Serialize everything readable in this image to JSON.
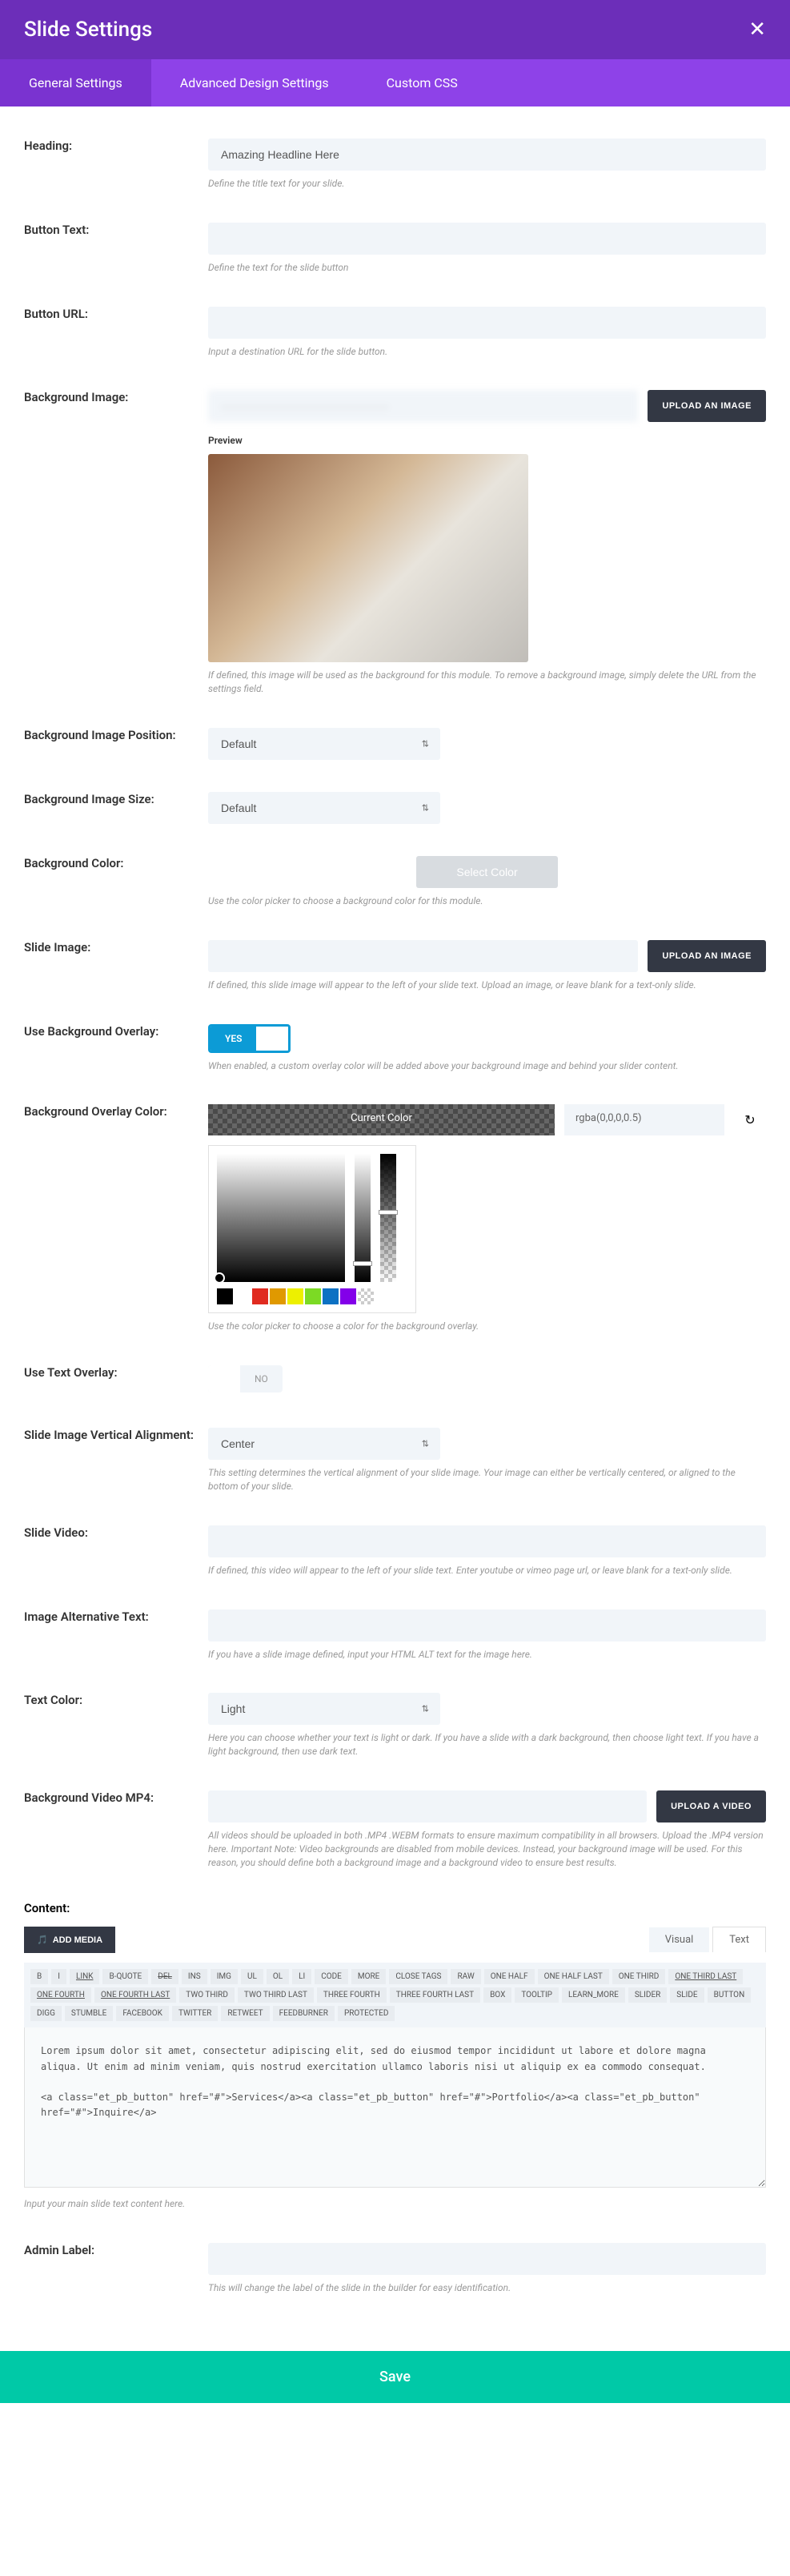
{
  "header": {
    "title": "Slide Settings"
  },
  "tabs": {
    "general": "General Settings",
    "advanced": "Advanced Design Settings",
    "css": "Custom CSS"
  },
  "fields": {
    "heading": {
      "label": "Heading:",
      "value": "Amazing Headline Here",
      "help": "Define the title text for your slide."
    },
    "button_text": {
      "label": "Button Text:",
      "help": "Define the text for the slide button"
    },
    "button_url": {
      "label": "Button URL:",
      "help": "Input a destination URL for the slide button."
    },
    "bg_image": {
      "label": "Background Image:",
      "upload": "UPLOAD AN IMAGE",
      "preview": "Preview",
      "help": "If defined, this image will be used as the background for this module. To remove a background image, simply delete the URL from the settings field."
    },
    "bg_pos": {
      "label": "Background Image Position:",
      "value": "Default"
    },
    "bg_size": {
      "label": "Background Image Size:",
      "value": "Default"
    },
    "bg_color": {
      "label": "Background Color:",
      "button": "Select Color",
      "help": "Use the color picker to choose a background color for this module."
    },
    "slide_image": {
      "label": "Slide Image:",
      "upload": "UPLOAD AN IMAGE",
      "help": "If defined, this slide image will appear to the left of your slide text. Upload an image, or leave blank for a text-only slide."
    },
    "use_overlay": {
      "label": "Use Background Overlay:",
      "yes": "YES",
      "help": "When enabled, a custom overlay color will be added above your background image and behind your slider content."
    },
    "overlay_color": {
      "label": "Background Overlay Color:",
      "current": "Current Color",
      "value": "rgba(0,0,0,0.5)",
      "help": "Use the color picker to choose a color for the background overlay."
    },
    "text_overlay": {
      "label": "Use Text Overlay:",
      "no": "NO"
    },
    "vert_align": {
      "label": "Slide Image Vertical Alignment:",
      "value": "Center",
      "help": "This setting determines the vertical alignment of your slide image. Your image can either be vertically centered, or aligned to the bottom of your slide."
    },
    "slide_video": {
      "label": "Slide Video:",
      "help": "If defined, this video will appear to the left of your slide text. Enter youtube or vimeo page url, or leave blank for a text-only slide."
    },
    "alt_text": {
      "label": "Image Alternative Text:",
      "help": "If you have a slide image defined, input your HTML ALT text for the image here."
    },
    "text_color": {
      "label": "Text Color:",
      "value": "Light",
      "help": "Here you can choose whether your text is light or dark. If you have a slide with a dark background, then choose light text. If you have a light background, then use dark text."
    },
    "bg_video": {
      "label": "Background Video MP4:",
      "upload": "UPLOAD A VIDEO",
      "help": "All videos should be uploaded in both .MP4 .WEBM formats to ensure maximum compatibility in all browsers. Upload the .MP4 version here. Important Note: Video backgrounds are disabled from mobile devices. Instead, your background image will be used. For this reason, you should define both a background image and a background video to ensure best results."
    },
    "admin_label": {
      "label": "Admin Label:",
      "help": "This will change the label of the slide in the builder for easy identification."
    }
  },
  "content": {
    "label": "Content:",
    "add_media": "ADD MEDIA",
    "tabs": {
      "visual": "Visual",
      "text": "Text"
    },
    "tools": [
      "B",
      "I",
      "LINK",
      "B-QUOTE",
      "DEL",
      "INS",
      "IMG",
      "UL",
      "OL",
      "LI",
      "CODE",
      "MORE",
      "CLOSE TAGS",
      "RAW",
      "ONE HALF",
      "ONE HALF LAST",
      "ONE THIRD",
      "ONE THIRD LAST",
      "ONE FOURTH",
      "ONE FOURTH LAST",
      "TWO THIRD",
      "TWO THIRD LAST",
      "THREE FOURTH",
      "THREE FOURTH LAST",
      "BOX",
      "TOOLTIP",
      "LEARN_MORE",
      "SLIDER",
      "SLIDE",
      "BUTTON",
      "DIGG",
      "STUMBLE",
      "FACEBOOK",
      "TWITTER",
      "RETWEET",
      "FEEDBURNER",
      "PROTECTED"
    ],
    "text": "Lorem ipsum dolor sit amet, consectetur adipiscing elit, sed do eiusmod tempor incididunt ut labore et dolore magna aliqua. Ut enim ad minim veniam, quis nostrud exercitation ullamco laboris nisi ut aliquip ex ea commodo consequat.\n\n<a class=\"et_pb_button\" href=\"#\">Services</a><a class=\"et_pb_button\" href=\"#\">Portfolio</a><a class=\"et_pb_button\" href=\"#\">Inquire</a>",
    "help": "Input your main slide text content here."
  },
  "swatches": [
    "#000000",
    "#ffffff",
    "#e02b20",
    "#e09900",
    "#edf000",
    "#7cda24",
    "#0c71c3",
    "#8300e9"
  ],
  "footer": {
    "save": "Save"
  }
}
